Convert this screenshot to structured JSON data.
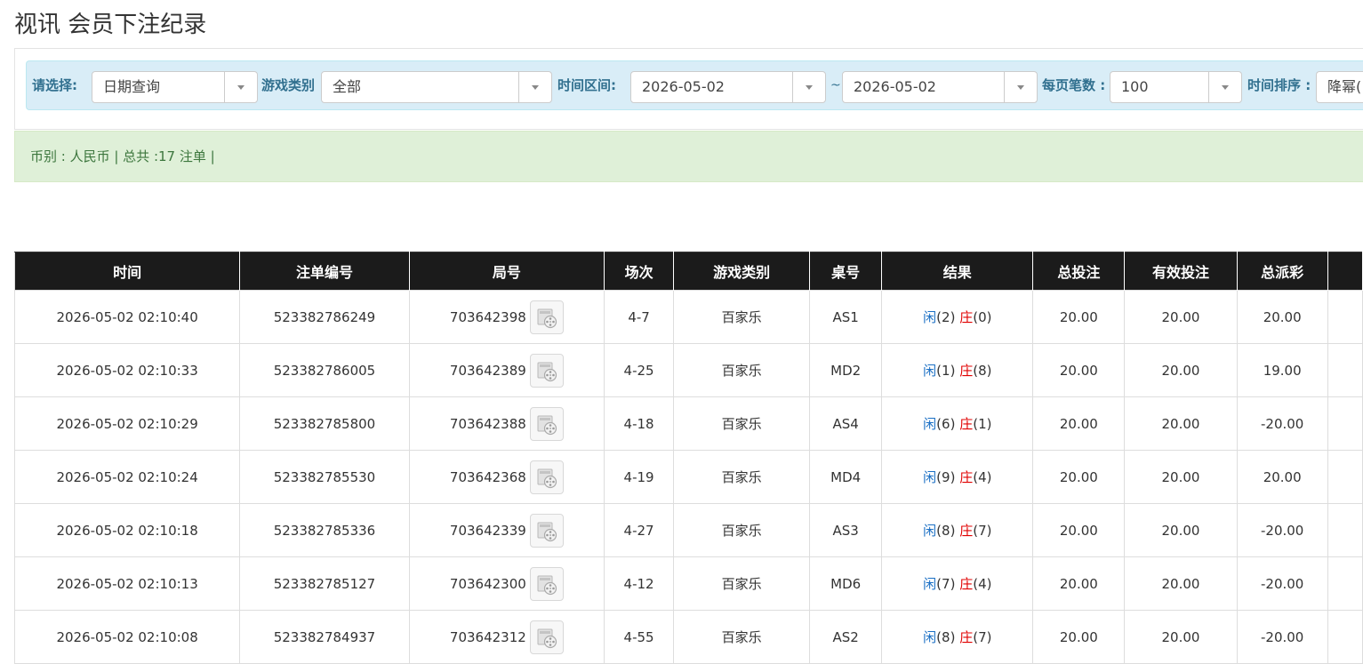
{
  "page": {
    "title": "视讯 会员下注纪录"
  },
  "filters": {
    "select_label": "请选择:",
    "query_type": "日期查询",
    "game_type_label": "游戏类别",
    "game_type": "全部",
    "time_range_label": "时间区间:",
    "start_date": "2026-05-02",
    "range_separator": "~",
    "end_date": "2026-05-02",
    "page_size_label": "每页笔数 :",
    "page_size": "100",
    "sort_label": "时间排序 :",
    "sort_order": "降幂("
  },
  "summary": {
    "text": "币别 : 人民币 | 总共 :17 注单 |"
  },
  "table": {
    "headers": [
      "时间",
      "注单编号",
      "局号",
      "场次",
      "游戏类别",
      "桌号",
      "结果",
      "总投注",
      "有效投注",
      "总派彩",
      ""
    ],
    "rows": [
      {
        "time": "2026-05-02 02:10:40",
        "bet_id": "523382786249",
        "round_id": "703642398",
        "session": "4-7",
        "game": "百家乐",
        "table": "AS1",
        "player_label": "闲",
        "player_score": "(2)",
        "banker_label": "庄",
        "banker_score": "(0)",
        "total_bet": "20.00",
        "valid_bet": "20.00",
        "payout": "20.00",
        "payout_negative": false
      },
      {
        "time": "2026-05-02 02:10:33",
        "bet_id": "523382786005",
        "round_id": "703642389",
        "session": "4-25",
        "game": "百家乐",
        "table": "MD2",
        "player_label": "闲",
        "player_score": "(1)",
        "banker_label": "庄",
        "banker_score": "(8)",
        "total_bet": "20.00",
        "valid_bet": "20.00",
        "payout": "19.00",
        "payout_negative": false
      },
      {
        "time": "2026-05-02 02:10:29",
        "bet_id": "523382785800",
        "round_id": "703642388",
        "session": "4-18",
        "game": "百家乐",
        "table": "AS4",
        "player_label": "闲",
        "player_score": "(6)",
        "banker_label": "庄",
        "banker_score": "(1)",
        "total_bet": "20.00",
        "valid_bet": "20.00",
        "payout": "-20.00",
        "payout_negative": true
      },
      {
        "time": "2026-05-02 02:10:24",
        "bet_id": "523382785530",
        "round_id": "703642368",
        "session": "4-19",
        "game": "百家乐",
        "table": "MD4",
        "player_label": "闲",
        "player_score": "(9)",
        "banker_label": "庄",
        "banker_score": "(4)",
        "total_bet": "20.00",
        "valid_bet": "20.00",
        "payout": "20.00",
        "payout_negative": false
      },
      {
        "time": "2026-05-02 02:10:18",
        "bet_id": "523382785336",
        "round_id": "703642339",
        "session": "4-27",
        "game": "百家乐",
        "table": "AS3",
        "player_label": "闲",
        "player_score": "(8)",
        "banker_label": "庄",
        "banker_score": "(7)",
        "total_bet": "20.00",
        "valid_bet": "20.00",
        "payout": "-20.00",
        "payout_negative": true
      },
      {
        "time": "2026-05-02 02:10:13",
        "bet_id": "523382785127",
        "round_id": "703642300",
        "session": "4-12",
        "game": "百家乐",
        "table": "MD6",
        "player_label": "闲",
        "player_score": "(7)",
        "banker_label": "庄",
        "banker_score": "(4)",
        "total_bet": "20.00",
        "valid_bet": "20.00",
        "payout": "-20.00",
        "payout_negative": true
      },
      {
        "time": "2026-05-02 02:10:08",
        "bet_id": "523382784937",
        "round_id": "703642312",
        "session": "4-55",
        "game": "百家乐",
        "table": "AS2",
        "player_label": "闲",
        "player_score": "(8)",
        "banker_label": "庄",
        "banker_score": "(7)",
        "total_bet": "20.00",
        "valid_bet": "20.00",
        "payout": "-20.00",
        "payout_negative": true
      }
    ]
  },
  "icons": {
    "video_replay": "video-replay-icon",
    "dropdown_arrow": "caret-down-icon"
  },
  "colors": {
    "header_bg": "#1b1b1b",
    "filter_bg": "#d9edf7",
    "filter_label": "#31708f",
    "summary_bg": "#dff0d8",
    "summary_text": "#3c763d",
    "player_blue": "#1a6fc4",
    "banker_red": "#e00000",
    "negative_red": "#e00000"
  }
}
